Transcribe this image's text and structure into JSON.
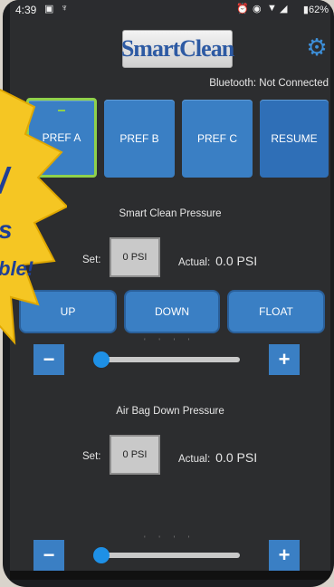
{
  "status_bar": {
    "time": "4:39",
    "battery": "62%"
  },
  "header": {
    "brand": "SmartClean"
  },
  "bluetooth_status": "Bluetooth: Not Connected",
  "presets": [
    {
      "label": "PREF A"
    },
    {
      "label": "PREF B"
    },
    {
      "label": "PREF C"
    },
    {
      "label": "RESUME"
    }
  ],
  "smart_clean": {
    "title": "Smart Clean Pressure",
    "set_label": "Set:",
    "set_value": "0 PSI",
    "actual_label": "Actual:",
    "actual_value": "0.0 PSI"
  },
  "controls": {
    "up": "UP",
    "down": "DOWN",
    "float": "FLOAT",
    "minus": "−",
    "plus": "+"
  },
  "air_bag": {
    "title": "Air Bag Down Pressure",
    "set_label": "Set:",
    "set_value": "0 PSI",
    "actual_label": "Actual:",
    "actual_value": "0.0 PSI"
  },
  "promo": {
    "line1": "/",
    "line2": "s",
    "line3": "ble!"
  },
  "colors": {
    "accent": "#3a7fc4",
    "selected": "#8fd14b",
    "background": "#2c2d2f"
  }
}
